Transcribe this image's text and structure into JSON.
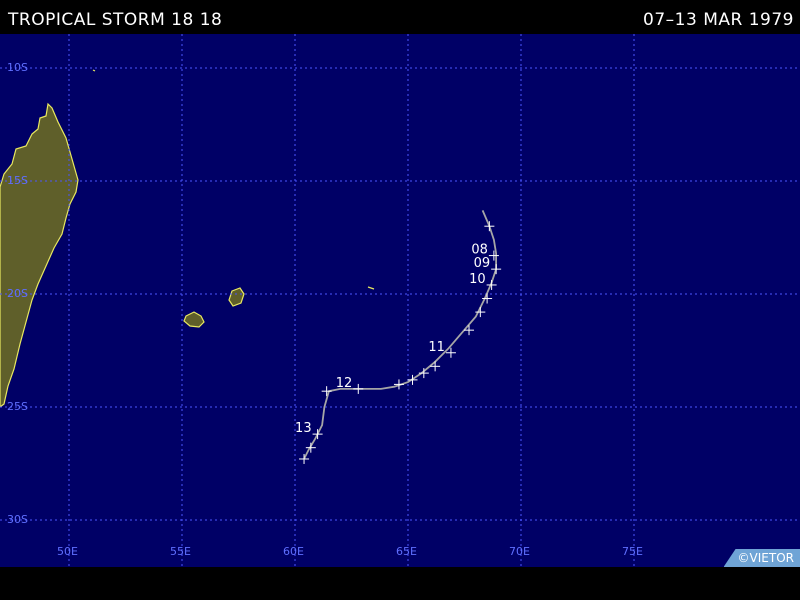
{
  "header": {
    "title": "TROPICAL STORM 18 18",
    "dates": "07–13 MAR 1979"
  },
  "map": {
    "lat_labels": [
      "10S",
      "15S",
      "20S",
      "25S",
      "30S"
    ],
    "lon_labels": [
      "50E",
      "55E",
      "60E",
      "65E",
      "70E",
      "75E"
    ],
    "credit": "©VIETOR",
    "colors": {
      "ocean": "#000066",
      "land": "#5f5f2a",
      "coast": "#e8e860",
      "grid": "#4b56ff",
      "track": "#a6a6a6",
      "marker": "#ffffff"
    }
  },
  "track": {
    "points": [
      [
        -16.3,
        68.3
      ],
      [
        -17.0,
        68.6
      ],
      [
        -17.6,
        68.8
      ],
      [
        -18.2,
        68.9
      ],
      [
        -18.9,
        68.9
      ],
      [
        -19.5,
        68.7
      ],
      [
        -20.2,
        68.4
      ],
      [
        -21.0,
        68.0
      ],
      [
        -21.7,
        67.4
      ],
      [
        -22.4,
        66.8
      ],
      [
        -23.0,
        66.2
      ],
      [
        -23.5,
        65.6
      ],
      [
        -23.9,
        65.0
      ],
      [
        -24.1,
        64.4
      ],
      [
        -24.2,
        63.8
      ],
      [
        -24.2,
        63.2
      ],
      [
        -24.2,
        62.6
      ],
      [
        -24.2,
        62.0
      ],
      [
        -24.3,
        61.5
      ],
      [
        -25.0,
        61.3
      ],
      [
        -25.8,
        61.2
      ],
      [
        -26.4,
        60.9
      ],
      [
        -26.9,
        60.6
      ],
      [
        -27.3,
        60.4
      ]
    ],
    "markers": [
      [
        -17.0,
        68.6
      ],
      [
        -18.3,
        68.8
      ],
      [
        -18.9,
        68.9
      ],
      [
        -19.6,
        68.7
      ],
      [
        -20.2,
        68.5
      ],
      [
        -20.8,
        68.2
      ],
      [
        -21.6,
        67.7
      ],
      [
        -22.6,
        66.9
      ],
      [
        -23.2,
        66.2
      ],
      [
        -23.5,
        65.7
      ],
      [
        -23.8,
        65.2
      ],
      [
        -24.0,
        64.6
      ],
      [
        -24.2,
        62.8
      ],
      [
        -24.3,
        61.4
      ],
      [
        -26.2,
        61.0
      ],
      [
        -26.8,
        60.7
      ],
      [
        -27.3,
        60.4
      ]
    ],
    "day_labels": [
      {
        "text": "08",
        "lat": -18.3,
        "lon": 68.8
      },
      {
        "text": "09",
        "lat": -18.9,
        "lon": 68.9
      },
      {
        "text": "10",
        "lat": -19.6,
        "lon": 68.7
      },
      {
        "text": "11",
        "lat": -22.6,
        "lon": 66.9
      },
      {
        "text": "12",
        "lat": -24.2,
        "lon": 62.8
      },
      {
        "text": "13",
        "lat": -26.2,
        "lon": 61.0
      }
    ]
  }
}
